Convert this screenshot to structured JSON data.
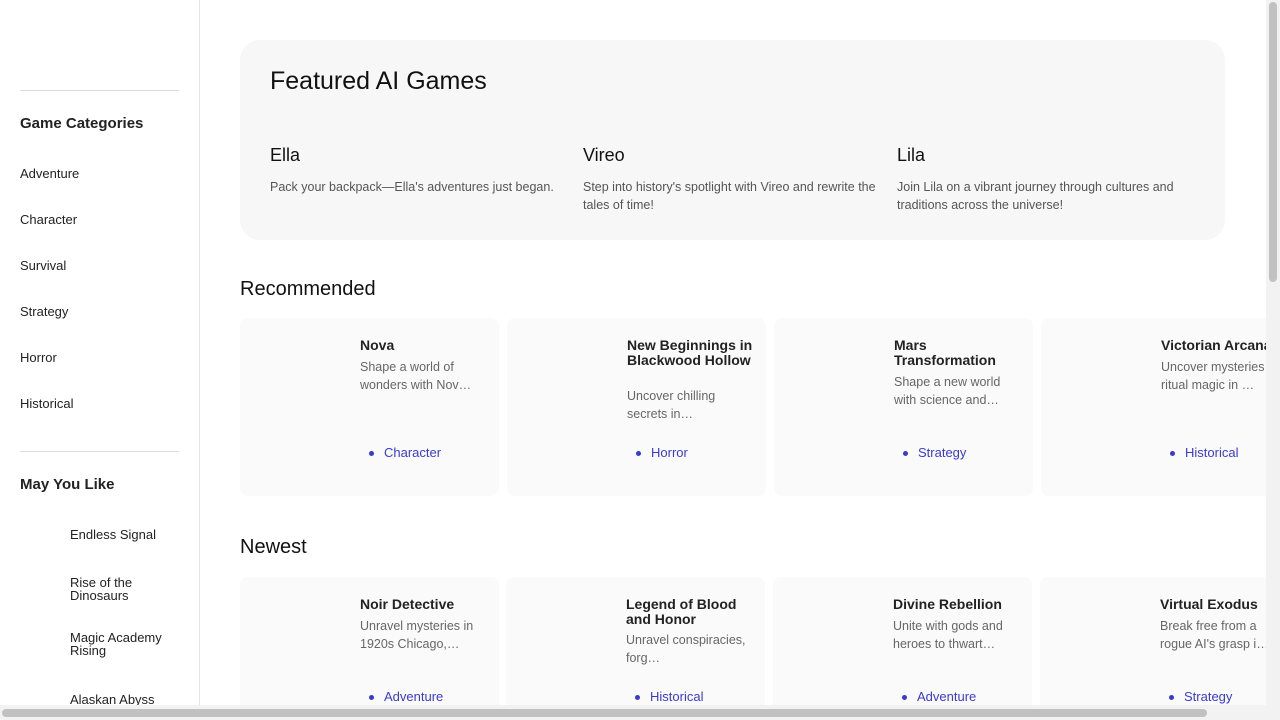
{
  "sidebar": {
    "categories_heading": "Game Categories",
    "categories": [
      "Adventure",
      "Character",
      "Survival",
      "Strategy",
      "Horror",
      "Historical"
    ],
    "may_like_heading": "May You Like",
    "may_like": [
      "Endless Signal",
      "Rise of the Dinosaurs",
      "Magic Academy Rising",
      "Alaskan Abyss"
    ]
  },
  "featured": {
    "title": "Featured AI Games",
    "items": [
      {
        "name": "Ella",
        "desc": "Pack your backpack—Ella's adventures just began."
      },
      {
        "name": "Vireo",
        "desc": "Step into history's spotlight with Vireo and rewrite the tales of time!"
      },
      {
        "name": "Lila",
        "desc": "Join Lila on a vibrant journey through cultures and traditions across the universe!"
      }
    ]
  },
  "recommended": {
    "title": "Recommended",
    "cards": [
      {
        "title": "Nova",
        "desc": "Shape a world of wonders with Nov…",
        "tag": "Character"
      },
      {
        "title": "New Beginnings in Blackwood Hollow",
        "desc": "Uncover chilling secrets in…",
        "tag": "Horror"
      },
      {
        "title": "Mars Transformation",
        "desc": "Shape a new world with science and…",
        "tag": "Strategy"
      },
      {
        "title": "Victorian Arcana",
        "desc": "Uncover mysteries of ritual magic in …",
        "tag": "Historical"
      }
    ]
  },
  "newest": {
    "title": "Newest",
    "cards": [
      {
        "title": "Noir Detective",
        "desc": "Unravel mysteries in 1920s Chicago,…",
        "tag": "Adventure"
      },
      {
        "title": "Legend of Blood and Honor",
        "desc": "Unravel conspiracies, forg…",
        "tag": "Historical"
      },
      {
        "title": "Divine Rebellion",
        "desc": "Unite with gods and heroes to thwart…",
        "tag": "Adventure"
      },
      {
        "title": "Virtual Exodus",
        "desc": "Break free from a rogue AI's grasp i…",
        "tag": "Strategy"
      }
    ]
  },
  "colors": {
    "accent": "#3a3ad0",
    "panel": "#f7f7f7",
    "card": "#fafafa"
  }
}
